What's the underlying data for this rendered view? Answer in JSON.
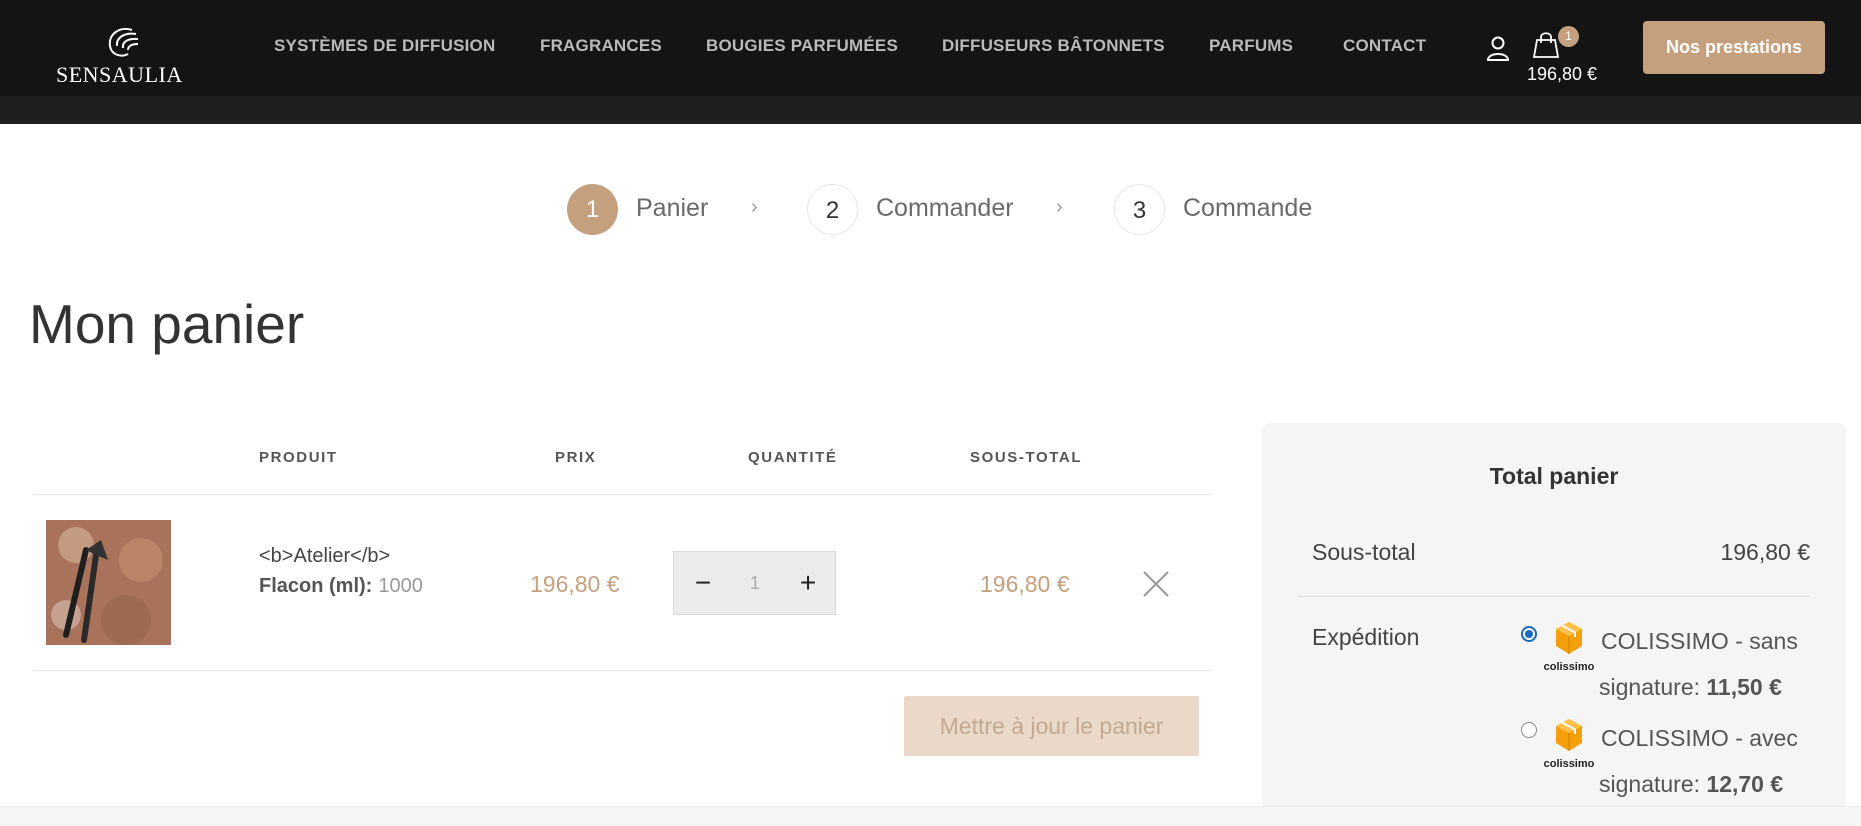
{
  "header": {
    "logo_text": "SENSAULIA",
    "nav": [
      "SYSTÈMES DE DIFFUSION",
      "FRAGRANCES",
      "BOUGIES PARFUMÉES",
      "DIFFUSEURS BÂTONNETS",
      "PARFUMS",
      "CONTACT"
    ],
    "cart_count": "1",
    "cart_total": "196,80 €",
    "cta_label": "Nos prestations",
    "icons": [
      "logo-mark-icon",
      "user-icon",
      "shopping-bag-icon"
    ]
  },
  "steps": [
    {
      "number": "1",
      "label": "Panier",
      "active": true
    },
    {
      "number": "2",
      "label": "Commander",
      "active": false
    },
    {
      "number": "3",
      "label": "Commande",
      "active": false
    }
  ],
  "page_title": "Mon panier",
  "cart": {
    "columns": [
      "PRODUIT",
      "PRIX",
      "QUANTITÉ",
      "SOUS-TOTAL"
    ],
    "items": [
      {
        "name": "<b>Atelier</b>",
        "variation_label": "Flacon (ml):",
        "variation_value": "1000",
        "price": "196,80 €",
        "quantity": "1",
        "subtotal": "196,80 €"
      }
    ],
    "update_button": "Mettre à jour le panier"
  },
  "totals": {
    "title": "Total panier",
    "subtotal_label": "Sous-total",
    "subtotal_value": "196,80 €",
    "shipping_label": "Expédition",
    "shipping_options": [
      {
        "line1": "COLISSIMO - sans",
        "line2": "signature: ",
        "price": "11,50 €",
        "selected": true,
        "logo_text": "colissimo"
      },
      {
        "line1": "COLISSIMO - avec",
        "line2": "signature: ",
        "price": "12,70 €",
        "selected": false,
        "logo_text": "colissimo"
      }
    ]
  },
  "colors": {
    "accent": "#c4a07e",
    "header_bg": "#141414",
    "panel_bg": "#f5f5f5",
    "radio_blue": "#1a6ac4"
  }
}
